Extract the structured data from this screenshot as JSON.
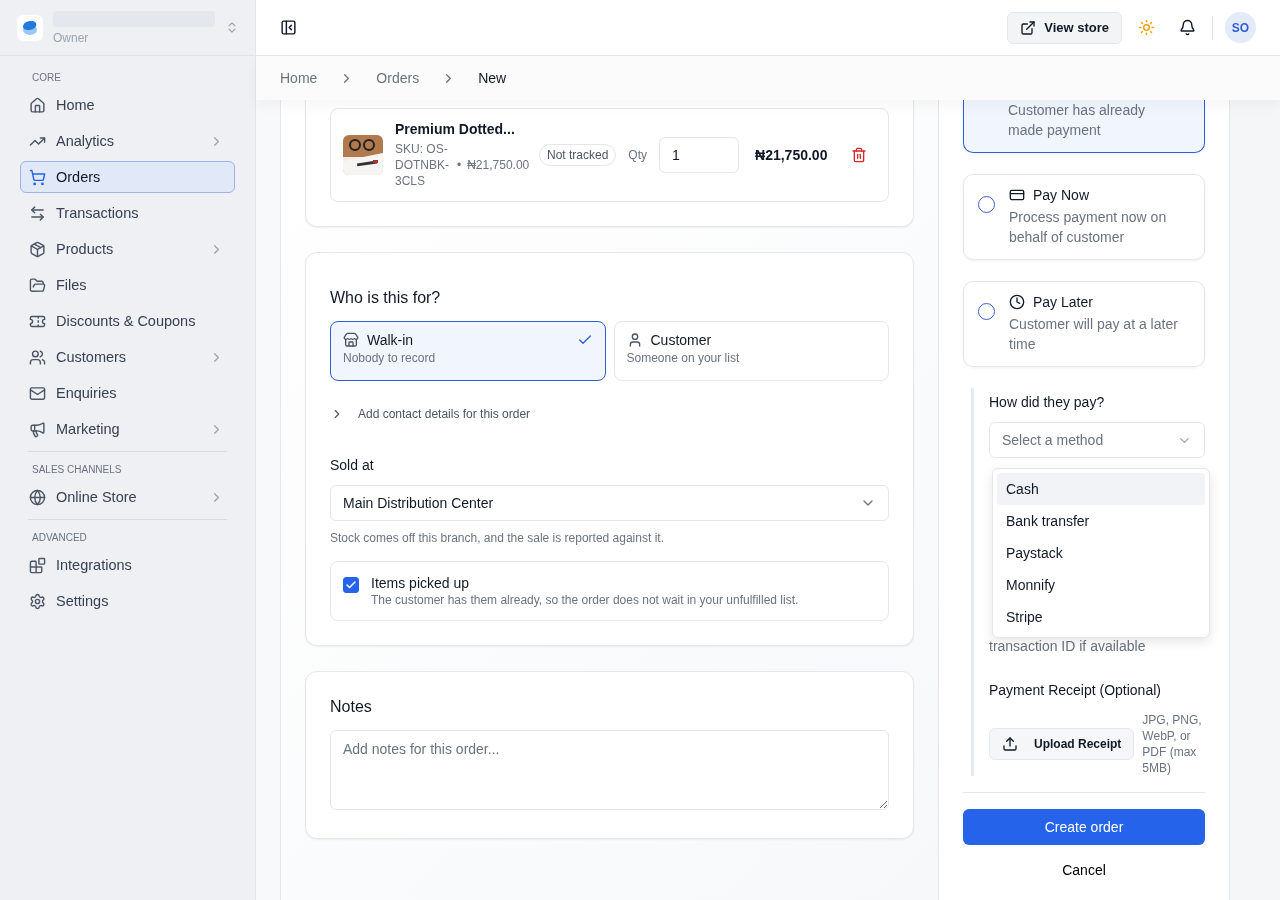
{
  "sidebar": {
    "workspace": {
      "role": "Owner"
    },
    "sections": [
      {
        "label": "CORE",
        "items": [
          {
            "label": "Home",
            "selected": false,
            "submenu": false
          },
          {
            "label": "Analytics",
            "selected": false,
            "submenu": true
          },
          {
            "label": "Orders",
            "selected": true,
            "submenu": false
          },
          {
            "label": "Transactions",
            "selected": false,
            "submenu": false
          },
          {
            "label": "Products",
            "selected": false,
            "submenu": true
          },
          {
            "label": "Files",
            "selected": false,
            "submenu": false
          },
          {
            "label": "Discounts & Coupons",
            "selected": false,
            "submenu": false
          },
          {
            "label": "Customers",
            "selected": false,
            "submenu": true
          },
          {
            "label": "Enquiries",
            "selected": false,
            "submenu": false
          },
          {
            "label": "Marketing",
            "selected": false,
            "submenu": true
          }
        ]
      },
      {
        "label": "SALES CHANNELS",
        "items": [
          {
            "label": "Online Store",
            "selected": false,
            "submenu": true
          }
        ]
      },
      {
        "label": "ADVANCED",
        "items": [
          {
            "label": "Integrations",
            "selected": false,
            "submenu": false
          },
          {
            "label": "Settings",
            "selected": false,
            "submenu": false
          }
        ]
      }
    ]
  },
  "topbar": {
    "view_store": "View store",
    "avatar": "SO"
  },
  "breadcrumb": [
    "Home",
    "Orders",
    "New"
  ],
  "product": {
    "name": "Premium Dotted...",
    "sku": "SKU: OS-DOTNBK-3CLS",
    "dot": "•",
    "price": "₦21,750.00",
    "badge": "Not tracked",
    "qty_label": "Qty",
    "qty": "1",
    "total": "₦21,750.00"
  },
  "who": {
    "title": "Who is this for?",
    "options": [
      {
        "title": "Walk-in",
        "description": "Nobody to record",
        "selected": true
      },
      {
        "title": "Customer",
        "description": "Someone on your list",
        "selected": false
      }
    ],
    "contact_toggle": {
      "label": "Add contact details for this order",
      "expanded": false
    },
    "sold_at": {
      "label": "Sold at",
      "value": "Main Distribution Center",
      "hint": "Stock comes off this branch, and the sale is reported against it."
    },
    "picked_up": {
      "label": "Items picked up",
      "description": "The customer has them already, so the order does not wait in your unfulfilled list.",
      "checked": true
    }
  },
  "notes": {
    "title": "Notes",
    "placeholder": "Add notes for this order..."
  },
  "payment": {
    "options": [
      {
        "description": "Customer has already made payment",
        "selected": true
      },
      {
        "title": "Pay Now",
        "description": "Process payment now on behalf of customer",
        "selected": false
      },
      {
        "title": "Pay Later",
        "description": "Customer will pay at a later time",
        "selected": false
      }
    ],
    "method": {
      "label": "How did they pay?",
      "placeholder": "Select a method",
      "menu": [
        {
          "label": "Cash",
          "selected": true
        },
        {
          "label": "Bank transfer",
          "selected": false
        },
        {
          "label": "Paystack",
          "selected": false
        },
        {
          "label": "Monnify",
          "selected": false
        },
        {
          "label": "Stripe",
          "selected": false
        }
      ]
    },
    "reference_hint": "transaction ID if available",
    "receipt": {
      "label": "Payment Receipt (Optional)",
      "button": "Upload Receipt",
      "note": "JPG, PNG, WebP, or PDF (max 5MB)"
    },
    "create": "Create order",
    "cancel": "Cancel"
  }
}
